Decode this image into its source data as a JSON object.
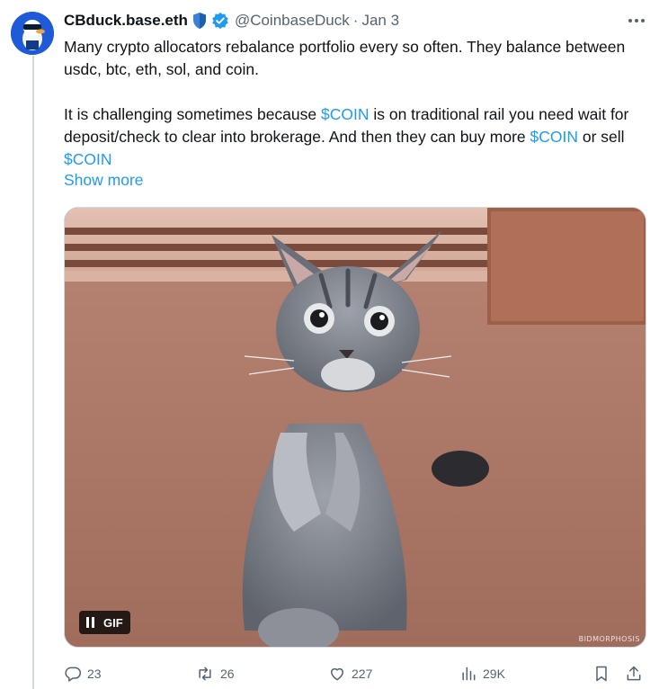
{
  "tweet": {
    "display_name": "CBduck.base.eth",
    "handle": "@CoinbaseDuck",
    "separator": "·",
    "date": "Jan 3",
    "text_line1": "Many crypto allocators rebalance portfolio every so often. They balance between usdc, btc, eth, sol, and coin.",
    "text_p2_a": "It is challenging sometimes because ",
    "cashtag": "$COIN",
    "text_p2_b": " is on traditional rail you need wait for deposit/check to clear into brokerage. And then they can buy more ",
    "text_p2_c": " or sell ",
    "show_more": "Show more"
  },
  "media": {
    "badge_label": "GIF",
    "watermark": "BIDMORPHOSIS"
  },
  "actions": {
    "replies": "23",
    "retweets": "26",
    "likes": "227",
    "views": "29K"
  },
  "icons": {
    "badge_shield": "shield-icon",
    "verified": "verified-badge-icon",
    "more": "more-options-icon",
    "reply": "reply-icon",
    "retweet": "retweet-icon",
    "like": "heart-icon",
    "views": "views-icon",
    "bookmark": "bookmark-icon",
    "share": "share-icon"
  },
  "colors": {
    "link": "#1d9bf0",
    "secondary_text": "#536471",
    "primary_text": "#0f1419",
    "verified": "#1d9bf0"
  }
}
